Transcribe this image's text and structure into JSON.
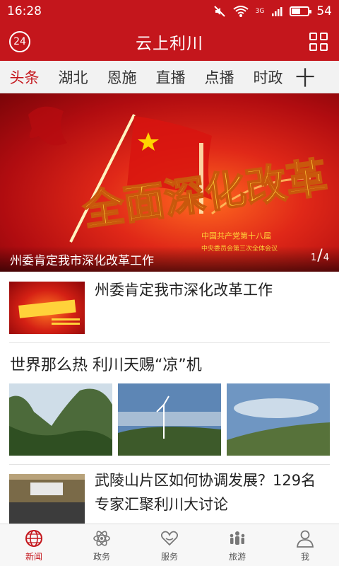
{
  "status_bar": {
    "time": "16:28",
    "network": "3G",
    "battery": "54",
    "battery_fraction": 0.54
  },
  "header": {
    "title": "云上利川",
    "badge": "24",
    "menu_icon": "grid-icon"
  },
  "tabs": [
    {
      "label": "头条",
      "active": true
    },
    {
      "label": "湖北",
      "active": false
    },
    {
      "label": "恩施",
      "active": false
    },
    {
      "label": "直播",
      "active": false
    },
    {
      "label": "点播",
      "active": false
    },
    {
      "label": "时政",
      "active": false
    }
  ],
  "tabs_more": "十",
  "banner": {
    "caption": "州委肯定我市深化改革工作",
    "page_current": "1",
    "page_total": "4",
    "art_text": "全面深化改革",
    "art_subtitle1": "中国共产党第十八届",
    "art_subtitle2": "中央委员会第三次全体会议"
  },
  "news": {
    "item1": {
      "headline": "州委肯定我市深化改革工作"
    },
    "item2": {
      "headline": "世界那么热 利川天赐“凉”机"
    },
    "item3": {
      "headline": "武陵山片区如何协调发展？129名专家汇聚利川大讨论"
    }
  },
  "bottom_nav": [
    {
      "label": "新闻",
      "icon": "globe-icon",
      "active": true
    },
    {
      "label": "政务",
      "icon": "atom-icon",
      "active": false
    },
    {
      "label": "服务",
      "icon": "heart-hands-icon",
      "active": false
    },
    {
      "label": "旅游",
      "icon": "people-icon",
      "active": false
    },
    {
      "label": "我",
      "icon": "user-icon",
      "active": false
    }
  ],
  "colors": {
    "brand": "#c4161c",
    "active": "#c4161c",
    "inactive": "#555555"
  }
}
